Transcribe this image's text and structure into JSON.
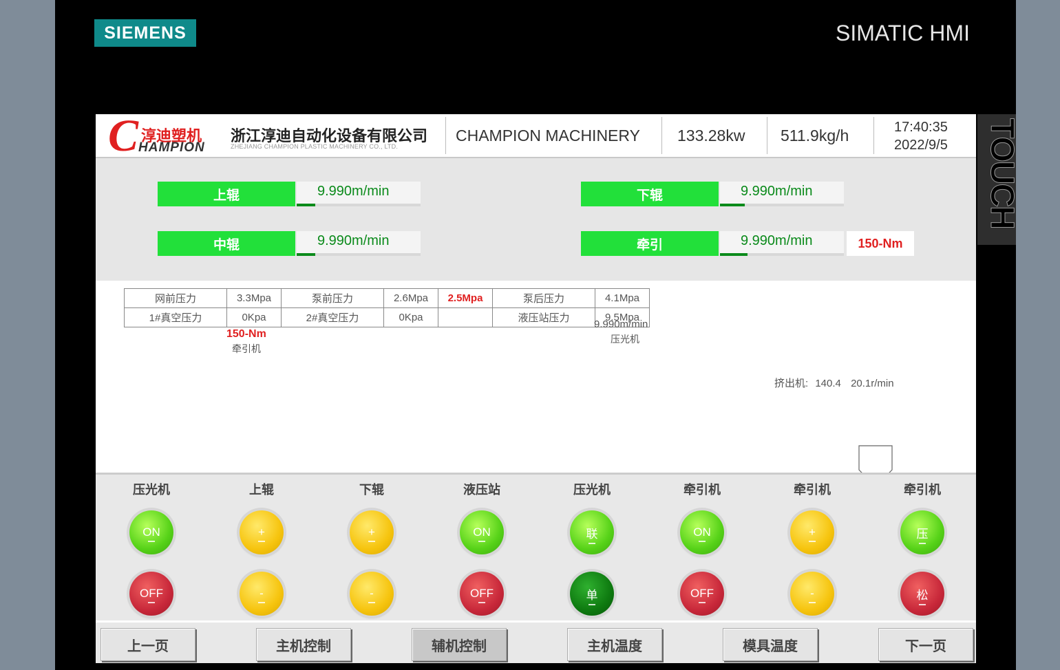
{
  "device": {
    "brand": "SIEMENS",
    "product": "SIMATIC HMI",
    "side_label": "TOUCH"
  },
  "header": {
    "logo_c": "C",
    "logo_cn": "淳迪塑机",
    "logo_en": "HAMPION",
    "company_cn": "浙江淳迪自动化设备有限公司",
    "company_en": "ZHEJIANG CHAMPION PLASTIC MACHINERY CO., LTD.",
    "title": "CHAMPION MACHINERY",
    "power": "133.28kw",
    "output": "511.9kg/h",
    "time": "17:40:35",
    "date": "2022/9/5"
  },
  "rollers": [
    {
      "label": "上辊",
      "speed": "9.990m/min",
      "level": 0.15
    },
    {
      "label": "下辊",
      "speed": "9.990m/min",
      "level": 0.2
    },
    {
      "label": "中辊",
      "speed": "9.990m/min",
      "level": 0.15
    },
    {
      "label": "牵引",
      "speed": "9.990m/min",
      "level": 0.22,
      "torque": "150-Nm"
    }
  ],
  "pressure_table": {
    "row1": [
      "网前压力",
      "3.3Mpa",
      "泵前压力",
      "2.6Mpa",
      "2.5Mpa",
      "泵后压力",
      "4.1Mpa"
    ],
    "row2": [
      "1#真空压力",
      "0Kpa",
      "2#真空压力",
      "0Kpa",
      "",
      "液压站压力",
      "9.5Mpa"
    ]
  },
  "diagram": {
    "puller_torque": "150-Nm",
    "puller_label": "牵引机",
    "calender_speed": "9.990m/min",
    "calender_label": "压光机",
    "extruder_label": "挤出机:",
    "extruder_value": "140.4",
    "extruder_rpm": "20.1r/min"
  },
  "controls": [
    {
      "label": "压光机",
      "top": "ON",
      "top_color": "green",
      "bottom": "OFF",
      "bottom_color": "red"
    },
    {
      "label": "上辊",
      "top": "+",
      "top_color": "yellow",
      "bottom": "-",
      "bottom_color": "yellow"
    },
    {
      "label": "下辊",
      "top": "+",
      "top_color": "yellow",
      "bottom": "-",
      "bottom_color": "yellow"
    },
    {
      "label": "液压站",
      "top": "ON",
      "top_color": "green",
      "bottom": "OFF",
      "bottom_color": "red"
    },
    {
      "label": "压光机",
      "top": "联",
      "top_color": "green",
      "bottom": "单",
      "bottom_color": "dark-green"
    },
    {
      "label": "牵引机",
      "top": "ON",
      "top_color": "green",
      "bottom": "OFF",
      "bottom_color": "red"
    },
    {
      "label": "牵引机",
      "top": "+",
      "top_color": "yellow",
      "bottom": "-",
      "bottom_color": "yellow"
    },
    {
      "label": "牵引机",
      "top": "压",
      "top_color": "green",
      "bottom": "松",
      "bottom_color": "red"
    }
  ],
  "nav": [
    "上一页",
    "主机控制",
    "辅机控制",
    "主机温度",
    "模具温度",
    "下一页"
  ],
  "nav_active": "辅机控制",
  "colors": {
    "accent_green": "#22e03a",
    "value_green": "#0a8a1a",
    "alarm_red": "#e02020",
    "siemens_teal": "#0f8a8a"
  }
}
